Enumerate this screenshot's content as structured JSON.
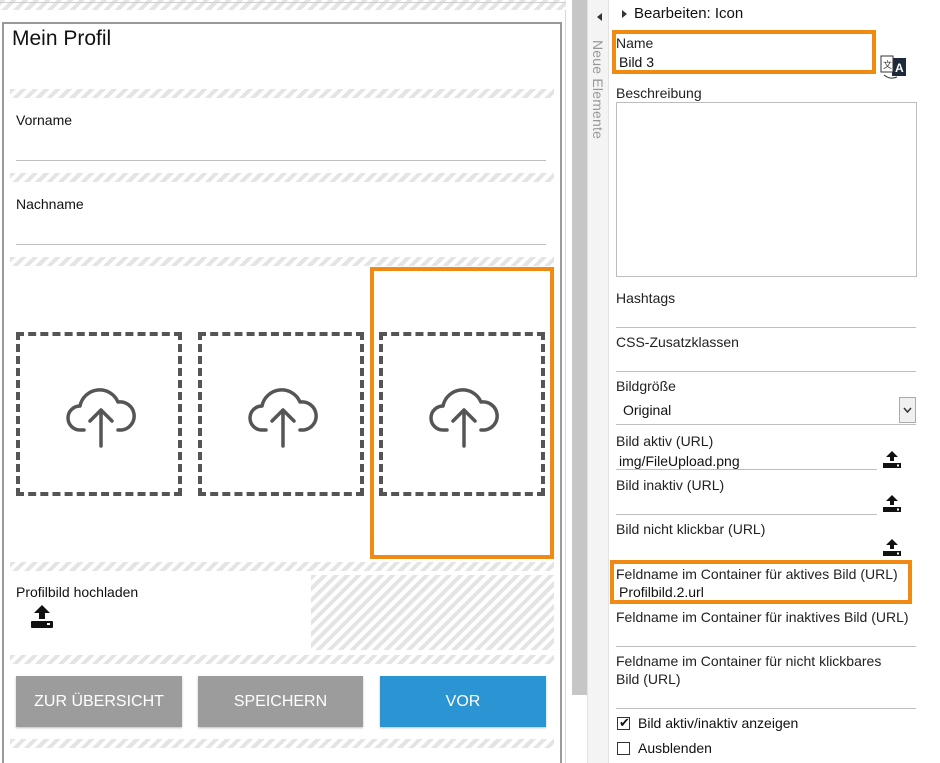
{
  "canvas": {
    "page_title": "Mein Profil",
    "fields": [
      {
        "label": "Vorname"
      },
      {
        "label": "Nachname"
      }
    ],
    "upload_label": "Profilbild hochladen",
    "buttons": {
      "overview": "ZUR ÜBERSICHT",
      "save": "SPEICHERN",
      "next": "VOR"
    }
  },
  "side_tab": {
    "label": "Neue Elemente"
  },
  "panel": {
    "header": "Bearbeiten: Icon",
    "name_label": "Name",
    "name_value": "Bild 3",
    "description_label": "Beschreibung",
    "hashtags_label": "Hashtags",
    "css_label": "CSS-Zusatzklassen",
    "image_size_label": "Bildgröße",
    "image_size_value": "Original",
    "image_active_label": "Bild aktiv (URL)",
    "image_active_value": "img/FileUpload.png",
    "image_inactive_label": "Bild inaktiv (URL)",
    "image_not_clickable_label": "Bild nicht klickbar (URL)",
    "field_active_label": "Feldname im Container für aktives Bild (URL)",
    "field_active_value": "Profilbild.2.url",
    "field_inactive_label": "Feldname im Container für inaktives Bild (URL)",
    "field_not_clickable_label_line1": "Feldname im Container für nicht klickbares",
    "field_not_clickable_label_line2": "Bild (URL)",
    "checkbox_show_active": "Bild aktiv/inaktiv anzeigen",
    "checkbox_show_active_checked": true,
    "checkbox_hide": "Ausblenden",
    "checkbox_hide_checked": false
  },
  "colors": {
    "highlight": "#f08a12",
    "primary_button": "#2b95d3",
    "secondary_button": "#9c9c9c"
  },
  "icons": [
    "cloud-upload-icon",
    "upload-icon",
    "translate-icon",
    "chevron-down-icon",
    "collapse-arrow-icon",
    "expand-arrow-icon",
    "checkmark-icon"
  ]
}
